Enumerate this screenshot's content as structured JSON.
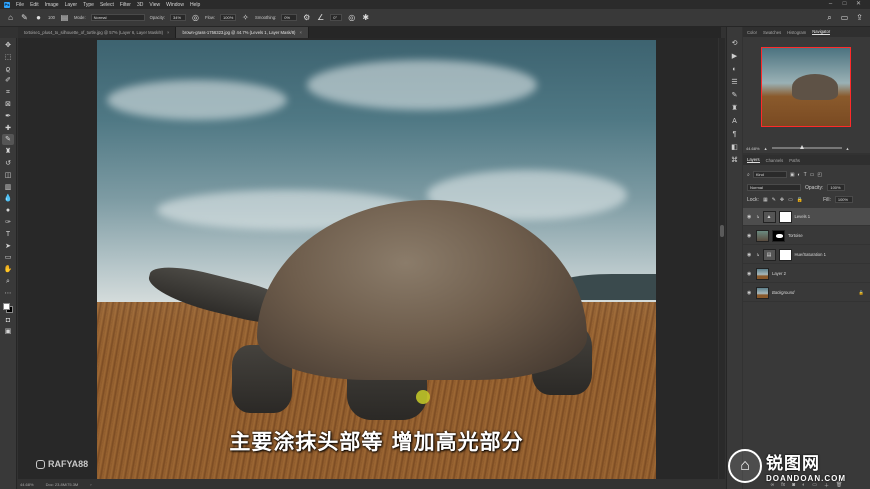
{
  "app": {
    "logo": "Ps",
    "menu": [
      "File",
      "Edit",
      "Image",
      "Layer",
      "Type",
      "Select",
      "Filter",
      "3D",
      "View",
      "Window",
      "Help"
    ]
  },
  "options": {
    "brush_size": "100",
    "mode_label": "Mode:",
    "mode_value": "Normal",
    "opacity_label": "Opacity:",
    "opacity_value": "34%",
    "flow_label": "Flow:",
    "flow_value": "100%",
    "smoothing_label": "Smoothing:",
    "smoothing_value": "0%",
    "angle_value": "0°"
  },
  "tabs": [
    {
      "label": "tortoise1_plus4_to_silhouette_of_turtle.jpg @ 57% (Layer 6, Layer Mask/8)",
      "active": false
    },
    {
      "label": "brown-grass-1756323.jpg @ 44.7% (Levels 1, Layer Mask/8)",
      "active": true
    }
  ],
  "canvas": {
    "subtitle": "主要涂抹头部等 增加高光部分",
    "watermark": "RAFYA88"
  },
  "status": {
    "zoom": "44.68%",
    "doc": "Doc: 23.8M/75.3M"
  },
  "navigator": {
    "tabs": [
      "Color",
      "Swatches",
      "Histogram",
      "Navigator"
    ],
    "active_tab": "Navigator",
    "zoom": "44.68%"
  },
  "layers": {
    "tabs": [
      "Layers",
      "Channels",
      "Paths"
    ],
    "active_tab": "Layers",
    "filter": "Kind",
    "blend_mode": "Normal",
    "opacity_label": "Opacity:",
    "opacity_value": "100%",
    "lock_label": "Lock:",
    "fill_label": "Fill:",
    "fill_value": "100%",
    "items": [
      {
        "name": "Levels 1",
        "selected": true
      },
      {
        "name": "Tortoise",
        "selected": false
      },
      {
        "name": "Hue/Saturation 1",
        "selected": false
      },
      {
        "name": "Layer 2",
        "selected": false
      },
      {
        "name": "Background",
        "selected": false
      }
    ]
  },
  "brand_watermark": {
    "title": "锐图网",
    "sub": "DOANDOAN.COM"
  }
}
